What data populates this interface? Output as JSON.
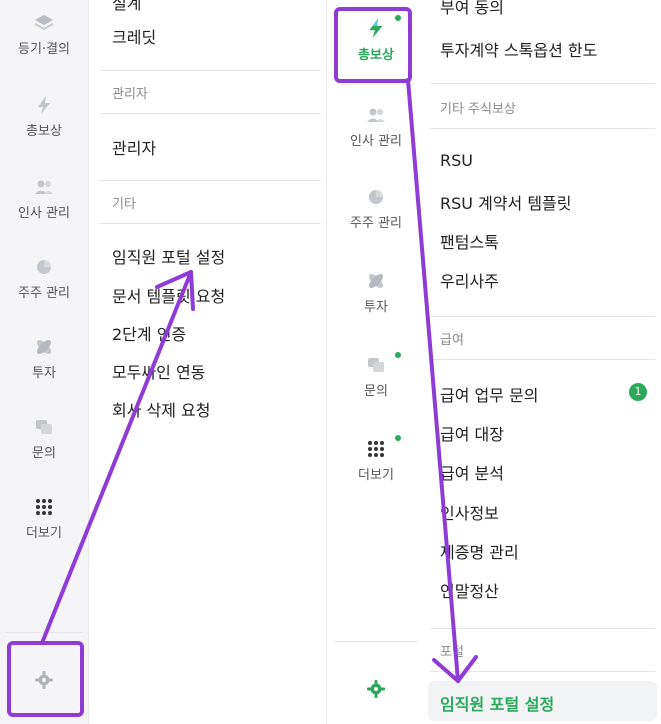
{
  "left_rail": {
    "items": [
      {
        "label": "등기·결의",
        "icon": "layers-icon"
      },
      {
        "label": "총보상",
        "icon": "bolt-icon"
      },
      {
        "label": "인사 관리",
        "icon": "people-icon"
      },
      {
        "label": "주주 관리",
        "icon": "pie-icon"
      },
      {
        "label": "투자",
        "icon": "orbit-icon"
      },
      {
        "label": "문의",
        "icon": "chat-icon"
      },
      {
        "label": "더보기",
        "icon": "grid-icon"
      }
    ],
    "settings_icon": "gear-icon"
  },
  "left_menu": {
    "top_partial": "설계",
    "credit": "크레딧",
    "admin_header": "관리자",
    "admin_item": "관리자",
    "etc_header": "기타",
    "etc_items": [
      "임직원 포털 설정",
      "문서 템플릿 요청",
      "2단계 인증",
      "모두싸인 연동",
      "회사 삭제 요청"
    ]
  },
  "right_rail": {
    "active_item": {
      "label": "총보상",
      "icon": "bolt-icon"
    },
    "items": [
      {
        "label": "인사 관리",
        "icon": "people-icon"
      },
      {
        "label": "주주 관리",
        "icon": "pie-icon"
      },
      {
        "label": "투자",
        "icon": "orbit-icon"
      },
      {
        "label": "문의",
        "icon": "chat-icon"
      },
      {
        "label": "더보기",
        "icon": "grid-icon"
      }
    ],
    "settings_icon": "gear-icon"
  },
  "right_menu": {
    "top_partial": "부여 동의",
    "option_limit": "투자계약 스톡옵션 한도",
    "other_header": "기타 주식보상",
    "other_items": [
      "RSU",
      "RSU 계약서 템플릿",
      "팬텀스톡",
      "우리사주"
    ],
    "pay_header": "급여",
    "pay_items": [
      "급여 업무 문의",
      "급여 대장",
      "급여 분석",
      "인사정보",
      "제증명 관리",
      "연말정산"
    ],
    "pay_badge": "1",
    "portal_header": "포털",
    "portal_item": "임직원 포털 설정"
  },
  "colors": {
    "accent_green": "#2aa95b",
    "annotation_purple": "#8f3bd6"
  }
}
